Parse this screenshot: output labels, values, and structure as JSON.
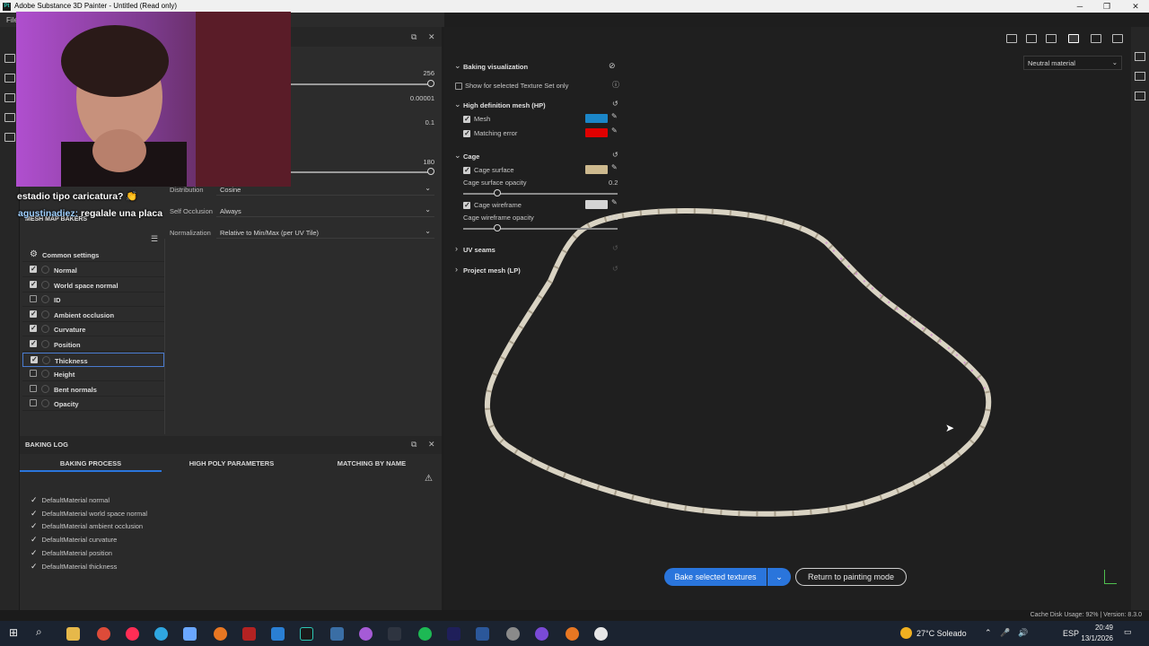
{
  "window": {
    "title": "Adobe Substance 3D Painter - Untitled (Read only)",
    "app_icon": "Pt",
    "controls": [
      "minimize",
      "maximize",
      "close"
    ]
  },
  "menu": {
    "file_label": "File"
  },
  "params": {
    "values": [
      "256",
      "0.00001",
      "0.1",
      "180"
    ],
    "distribution": {
      "label": "Distribution",
      "value": "Cosine"
    },
    "self_occlusion": {
      "label": "Self Occlusion",
      "value": "Always"
    },
    "normalization": {
      "label": "Normalization",
      "value": "Relative to Min/Max (per UV Tile)"
    }
  },
  "mesh_map_bakers": {
    "title": "MESH MAP BAKERS",
    "common_settings": "Common settings",
    "items": [
      {
        "label": "Normal",
        "checked": true
      },
      {
        "label": "World space normal",
        "checked": true
      },
      {
        "label": "ID",
        "checked": false
      },
      {
        "label": "Ambient occlusion",
        "checked": true
      },
      {
        "label": "Curvature",
        "checked": true
      },
      {
        "label": "Position",
        "checked": true
      },
      {
        "label": "Thickness",
        "checked": true,
        "selected": true
      },
      {
        "label": "Height",
        "checked": false
      },
      {
        "label": "Bent normals",
        "checked": false
      },
      {
        "label": "Opacity",
        "checked": false
      }
    ]
  },
  "baking_log": {
    "title": "BAKING LOG",
    "tabs": [
      "BAKING PROCESS",
      "HIGH POLY PARAMETERS",
      "MATCHING BY NAME"
    ],
    "lines": [
      "DefaultMaterial normal",
      "DefaultMaterial world space normal",
      "DefaultMaterial ambient occlusion",
      "DefaultMaterial curvature",
      "DefaultMaterial position",
      "DefaultMaterial thickness"
    ]
  },
  "baking_viz": {
    "title": "Baking visualization",
    "show_selected": "Show for selected Texture Set only",
    "hp_title": "High definition mesh (HP)",
    "mesh_label": "Mesh",
    "mesh_color": "#1b86c8",
    "matching_error_label": "Matching error",
    "matching_error_color": "#e00000",
    "cage_title": "Cage",
    "cage_surface_label": "Cage surface",
    "cage_surface_color": "#cdb98e",
    "cage_surface_opacity_label": "Cage surface opacity",
    "cage_surface_opacity": "0.2",
    "cage_wireframe_label": "Cage wireframe",
    "cage_wireframe_color": "#d4d4d4",
    "cage_wireframe_opacity_label": "Cage wireframe opacity",
    "cage_wireframe_opacity": "0.2",
    "uv_seams": "UV seams",
    "project_mesh": "Project mesh (LP)"
  },
  "viewport": {
    "material": "Neutral material",
    "bake_button": "Bake selected textures",
    "return_button": "Return to painting mode"
  },
  "status": {
    "text": "Cache Disk Usage:   92%  |  Version: 8.3.0"
  },
  "stream": {
    "chat1": "estadio tipo caricatura? 👏",
    "chat2_user": "agustinadiez:",
    "chat2_msg": "regalale una placa"
  },
  "taskbar": {
    "weather": "27°C  Soleado",
    "lang": "ESP",
    "time": "20:49",
    "date": "13/1/2026"
  }
}
